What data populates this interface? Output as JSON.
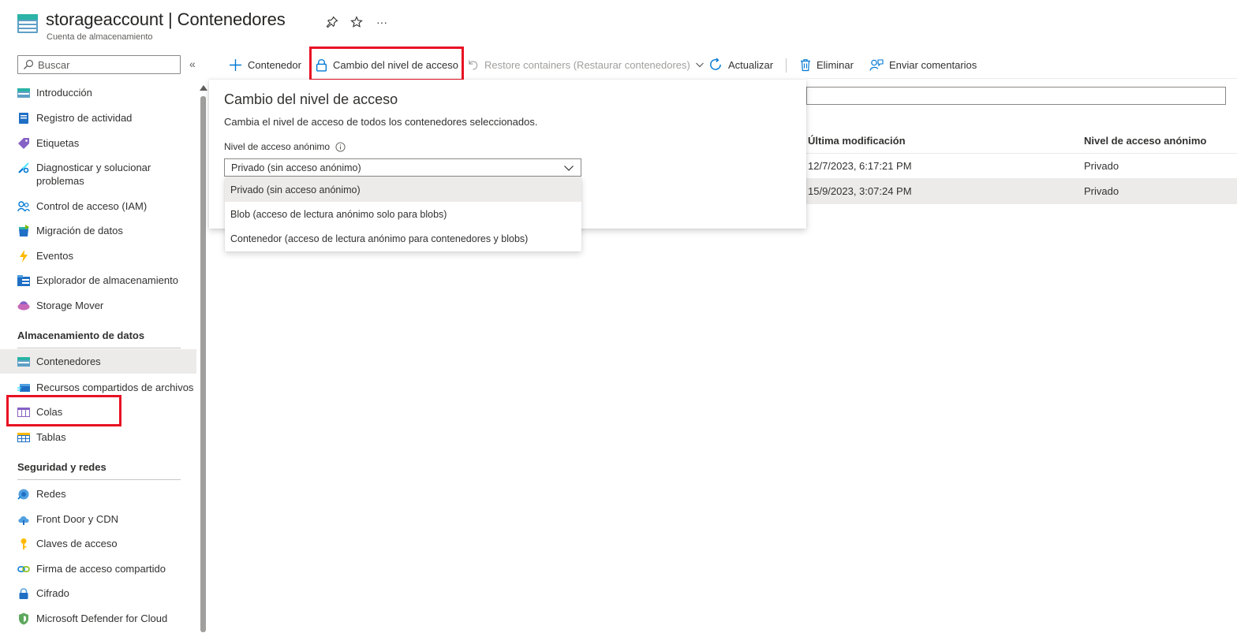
{
  "header": {
    "title": "storageaccount | Contenedores",
    "subtitle": "Cuenta de almacenamiento",
    "more": "···"
  },
  "sidebar": {
    "search_placeholder": "Buscar",
    "collapse": "«",
    "items_top": [
      {
        "label": "Introducción",
        "icon": "storage-overview-icon"
      },
      {
        "label": "Registro de actividad",
        "icon": "activity-log-icon"
      },
      {
        "label": "Etiquetas",
        "icon": "tag-icon"
      },
      {
        "label": "Diagnosticar y solucionar problemas",
        "icon": "wrench-icon"
      },
      {
        "label": "Control de acceso (IAM)",
        "icon": "people-icon"
      },
      {
        "label": "Migración de datos",
        "icon": "data-migration-icon"
      },
      {
        "label": "Eventos",
        "icon": "lightning-icon"
      },
      {
        "label": "Explorador de almacenamiento",
        "icon": "storage-explorer-icon"
      },
      {
        "label": "Storage Mover",
        "icon": "storage-mover-icon"
      }
    ],
    "section_data": "Almacenamiento de datos",
    "items_data": [
      {
        "label": "Contenedores",
        "icon": "containers-icon"
      },
      {
        "label": "Recursos compartidos de archivos",
        "icon": "file-share-icon"
      },
      {
        "label": "Colas",
        "icon": "queue-icon"
      },
      {
        "label": "Tablas",
        "icon": "table-icon"
      }
    ],
    "section_security": "Seguridad y redes",
    "items_security": [
      {
        "label": "Redes",
        "icon": "network-icon"
      },
      {
        "label": "Front Door y CDN",
        "icon": "cloud-icon"
      },
      {
        "label": "Claves de acceso",
        "icon": "key-icon"
      },
      {
        "label": "Firma de acceso compartido",
        "icon": "link-icon"
      },
      {
        "label": "Cifrado",
        "icon": "lock-icon"
      },
      {
        "label": "Microsoft Defender for Cloud",
        "icon": "shield-icon"
      }
    ]
  },
  "toolbar": {
    "add_container": "Contenedor",
    "change_access": "Cambio del nivel de acceso",
    "restore": "Restore containers (Restaurar contenedores)",
    "refresh": "Actualizar",
    "delete": "Eliminar",
    "feedback": "Enviar comentarios"
  },
  "table": {
    "col_modified": "Última modificación",
    "col_access": "Nivel de acceso anónimo",
    "rows": [
      {
        "modified": "12/7/2023, 6:17:21 PM",
        "access": "Privado"
      },
      {
        "modified": "15/9/2023, 3:07:24 PM",
        "access": "Privado"
      }
    ]
  },
  "panel": {
    "title": "Cambio del nivel de acceso",
    "description": "Cambia el nivel de acceso de todos los contenedores seleccionados.",
    "label": "Nivel de acceso anónimo",
    "selected": "Privado (sin acceso anónimo)",
    "options": [
      "Privado (sin acceso anónimo)",
      "Blob (acceso de lectura anónimo solo para blobs)",
      "Contenedor (acceso de lectura anónimo para contenedores y blobs)"
    ]
  },
  "colors": {
    "accent": "#0078d4",
    "highlight": "#e81123",
    "selected_bg": "#edebe9"
  }
}
